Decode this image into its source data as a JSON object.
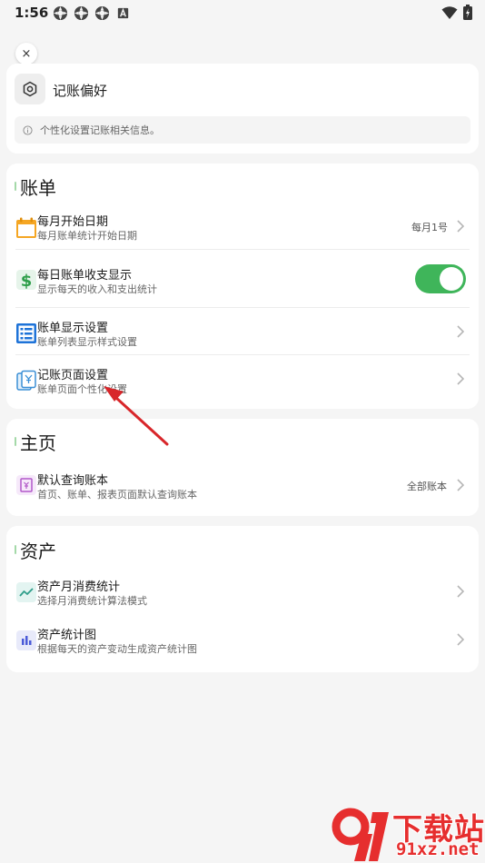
{
  "status_bar": {
    "time": "1:56",
    "notification_icons": [
      "app-notification-icon",
      "app-notification-icon",
      "app-notification-icon",
      "a-letter-notification-icon"
    ],
    "right_icons": [
      "wifi-icon",
      "battery-charging-icon"
    ]
  },
  "close_button": {
    "label": "×"
  },
  "preferences": {
    "title": "记账偏好",
    "icon": "gear-icon",
    "info_text": "个性化设置记账相关信息。"
  },
  "sections": {
    "bill": {
      "title": "账单",
      "items": [
        {
          "title": "每月开始日期",
          "subtitle": "每月账单统计开始日期",
          "value": "每月1号",
          "icon": "calendar-icon",
          "icon_color": "#f5a623"
        },
        {
          "title": "每日账单收支显示",
          "subtitle": "显示每天的收入和支出统计",
          "toggle_on": true,
          "icon": "dollar-icon",
          "icon_color": "#2e9e4a"
        },
        {
          "title": "账单显示设置",
          "subtitle": "账单列表显示样式设置",
          "icon": "list-icon",
          "icon_color": "#1e73d8"
        },
        {
          "title": "记账页面设置",
          "subtitle": "账单页面个性化设置",
          "icon": "receipt-icon",
          "icon_color": "#3b8fd6"
        }
      ]
    },
    "home": {
      "title": "主页",
      "items": [
        {
          "title": "默认查询账本",
          "subtitle": "首页、账单、报表页面默认查询账本",
          "value": "全部账本",
          "icon": "ledger-icon",
          "icon_color": "#b259c9"
        }
      ]
    },
    "assets": {
      "title": "资产",
      "items": [
        {
          "title": "资产月消费统计",
          "subtitle": "选择月消费统计算法模式",
          "icon": "trend-chart-icon",
          "icon_color": "#2e9e8a"
        },
        {
          "title": "资产统计图",
          "subtitle": "根据每天的资产变动生成资产统计图",
          "icon": "bar-chart-icon",
          "icon_color": "#4a5ad8"
        }
      ]
    }
  },
  "colors": {
    "background": "#f5f5f5",
    "card": "#ffffff",
    "toggle_on": "#3fb55a",
    "section_accent": "#a4d9a8",
    "annotation_arrow": "#d8262a",
    "watermark": "#e62e2e"
  },
  "watermark": {
    "text": "下载站",
    "url": "91xz.net"
  }
}
